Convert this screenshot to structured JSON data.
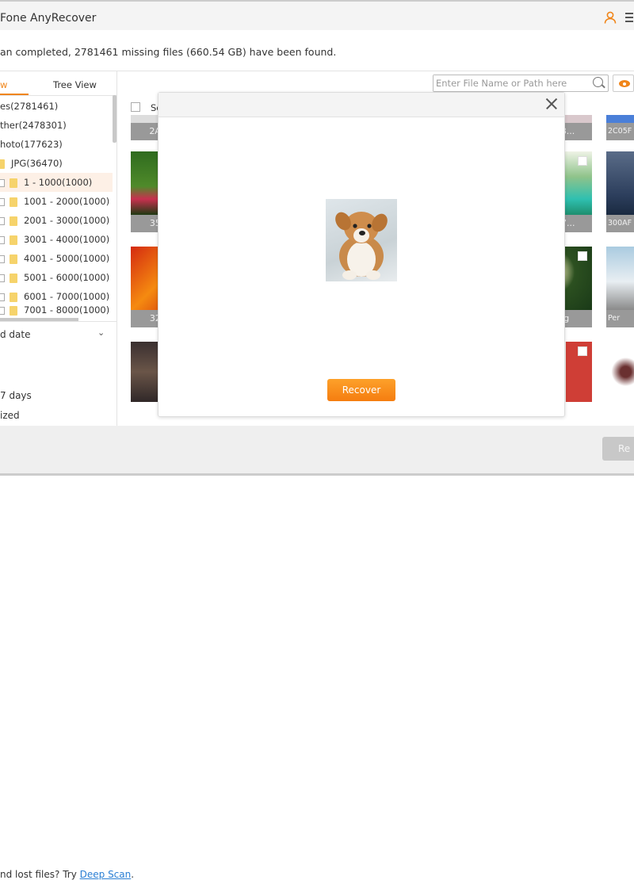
{
  "app": {
    "title": "Fone AnyRecover"
  },
  "scan_message": "an completed, 2781461 missing files (660.54 GB) have been found.",
  "tabs": [
    {
      "label": "w",
      "active": true
    },
    {
      "label": "Tree View",
      "active": false
    }
  ],
  "tree": [
    {
      "label": "es(2781461)"
    },
    {
      "label": "ther(2478301)"
    },
    {
      "label": "hoto(177623)"
    },
    {
      "label": "JPG(36470)"
    },
    {
      "label": "1 - 1000(1000)",
      "selected": true
    },
    {
      "label": "1001 - 2000(1000)"
    },
    {
      "label": "2001 - 3000(1000)"
    },
    {
      "label": "3001 - 4000(1000)"
    },
    {
      "label": "4001 - 5000(1000)"
    },
    {
      "label": "5001 - 6000(1000)"
    },
    {
      "label": "6001 - 7000(1000)"
    },
    {
      "label": "7001 - 8000(1000)"
    }
  ],
  "filter": {
    "label": "d date",
    "options": [
      "7 days",
      "ized"
    ]
  },
  "search": {
    "placeholder": "Enter File Name or Path here",
    "value": ""
  },
  "select_all_label": "Se",
  "thumbnails": {
    "col1": [
      "2A0AF",
      "3500F",
      "3205F",
      ""
    ],
    "col2": [
      "E368...",
      "5B37...",
      "-.jpg",
      ""
    ],
    "col3": [
      "2C05F",
      "300AF",
      "Per",
      ""
    ]
  },
  "status_text": "... found.",
  "footer": {
    "hint_prefix": "nd lost files? Try ",
    "deep_scan": "Deep Scan",
    "hint_suffix": ".",
    "recover_label": "Re"
  },
  "modal": {
    "recover_label": "Recover"
  },
  "colors": {
    "accent": "#f08519",
    "link": "#2a7fd4"
  }
}
